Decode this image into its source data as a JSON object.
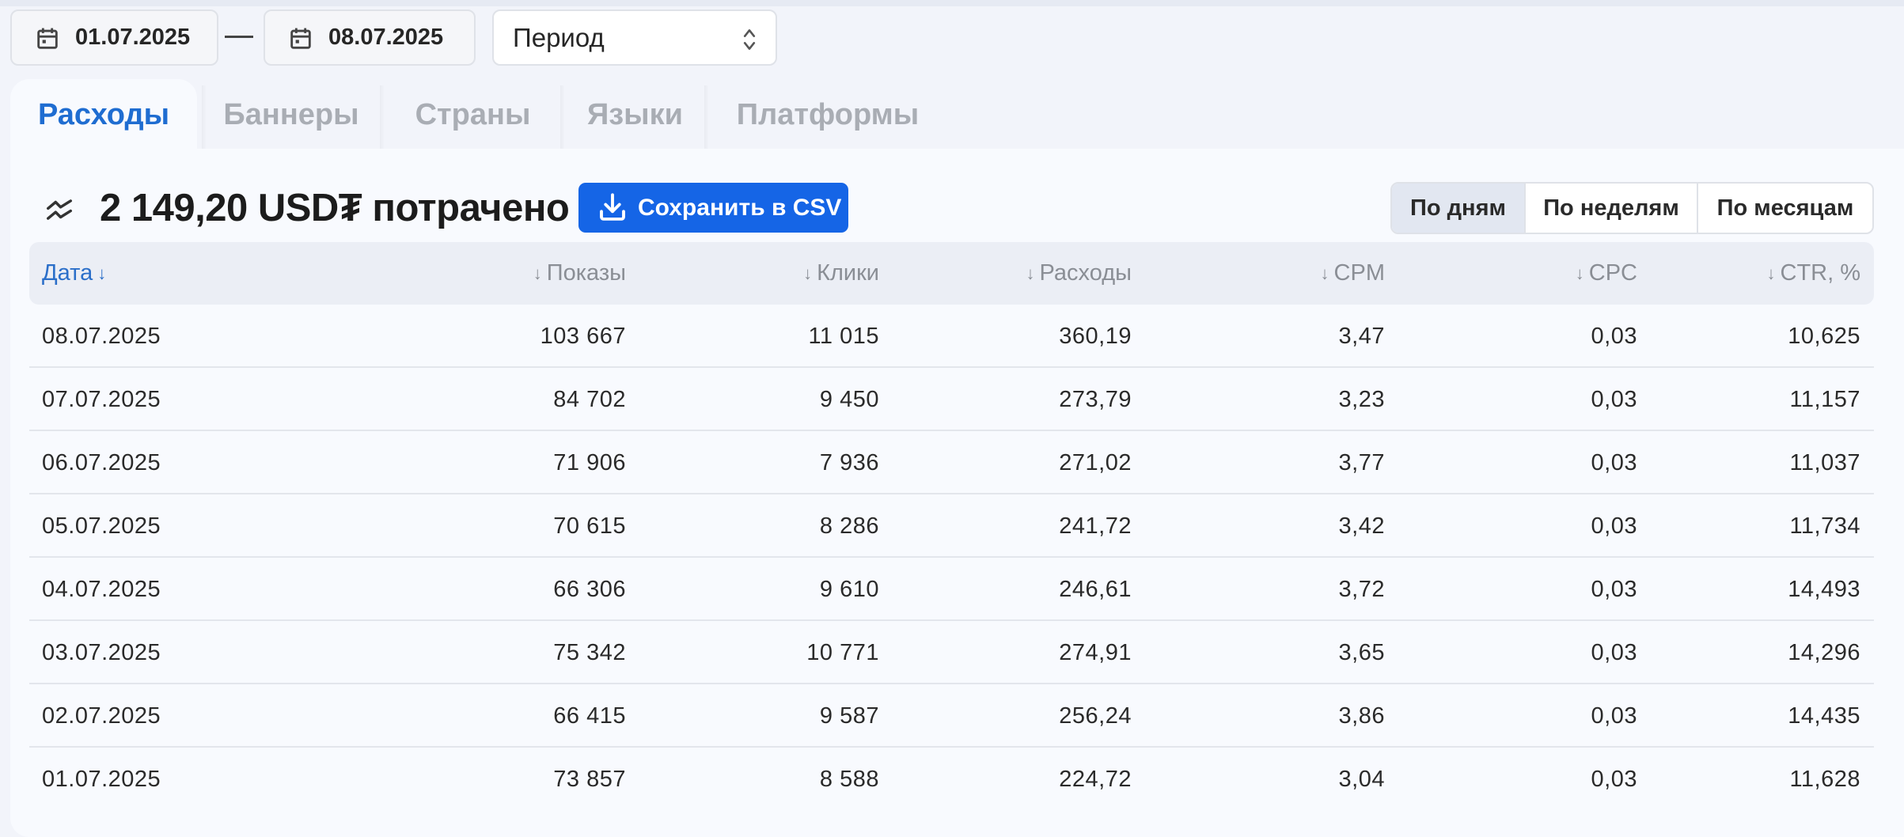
{
  "dates": {
    "from": "01.07.2025",
    "to": "08.07.2025",
    "separator": "—",
    "icon": "calendar-icon"
  },
  "period": {
    "value": "Период",
    "icon": "chevron-up-down-icon"
  },
  "tabs": [
    {
      "label": "Расходы",
      "active": true
    },
    {
      "label": "Баннеры",
      "active": false
    },
    {
      "label": "Страны",
      "active": false
    },
    {
      "label": "Языки",
      "active": false
    },
    {
      "label": "Платформы",
      "active": false
    }
  ],
  "summary": {
    "icon": "trend-icon",
    "spent_text": "2 149,20 USD₮ потрачено",
    "csv_button": "Сохранить в CSV",
    "csv_icon": "download-icon"
  },
  "grouping": {
    "options": [
      "По дням",
      "По неделям",
      "По месяцам"
    ],
    "selected": "По дням"
  },
  "table": {
    "sort_arrow": "↓",
    "columns": [
      "Дата",
      "Показы",
      "Клики",
      "Расходы",
      "CPM",
      "CPC",
      "CTR, %"
    ],
    "sorted_column": "Дата",
    "rows": [
      [
        "08.07.2025",
        "103 667",
        "11 015",
        "360,19",
        "3,47",
        "0,03",
        "10,625"
      ],
      [
        "07.07.2025",
        "84 702",
        "9 450",
        "273,79",
        "3,23",
        "0,03",
        "11,157"
      ],
      [
        "06.07.2025",
        "71 906",
        "7 936",
        "271,02",
        "3,77",
        "0,03",
        "11,037"
      ],
      [
        "05.07.2025",
        "70 615",
        "8 286",
        "241,72",
        "3,42",
        "0,03",
        "11,734"
      ],
      [
        "04.07.2025",
        "66 306",
        "9 610",
        "246,61",
        "3,72",
        "0,03",
        "14,493"
      ],
      [
        "03.07.2025",
        "75 342",
        "10 771",
        "274,91",
        "3,65",
        "0,03",
        "14,296"
      ],
      [
        "02.07.2025",
        "66 415",
        "9 587",
        "256,24",
        "3,86",
        "0,03",
        "14,435"
      ],
      [
        "01.07.2025",
        "73 857",
        "8 588",
        "224,72",
        "3,04",
        "0,03",
        "11,628"
      ]
    ]
  },
  "colors": {
    "accent": "#1f6dd1",
    "button": "#1565e6",
    "background": "#f2f4fa",
    "panel": "#f8fafe"
  }
}
